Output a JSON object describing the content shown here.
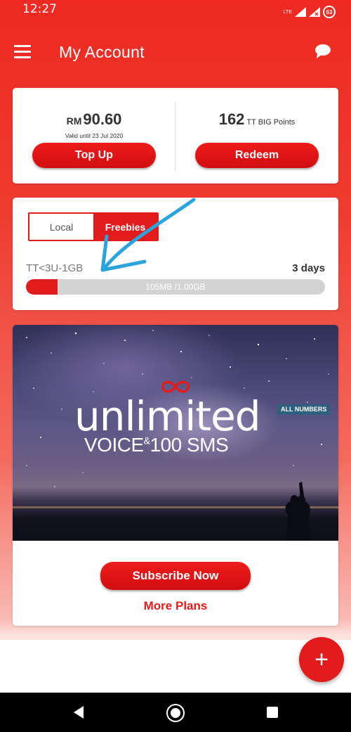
{
  "status_bar": {
    "time": "12:27",
    "network": "LTE",
    "battery": "63"
  },
  "header": {
    "title": "My Account",
    "menu_icon": "hamburger-menu-icon",
    "chat_icon": "chat-bubble-icon"
  },
  "balance": {
    "currency": "RM",
    "amount": "90.60",
    "valid_until": "Valid until 23 Jul 2020",
    "topup_label": "Top Up"
  },
  "points": {
    "value": "162",
    "label": "TT BIG Points",
    "redeem_label": "Redeem"
  },
  "usage": {
    "tabs": [
      {
        "label": "Local",
        "active": false
      },
      {
        "label": "Freebies",
        "active": true
      }
    ],
    "plan_name": "TT<3U-1GB",
    "days_left": "3 days",
    "usage_text": "105MB /1.00GB",
    "used_fraction": 0.105
  },
  "promo": {
    "headline": "unlimited",
    "badge": "ALL NUMBERS",
    "subline_voice": "VOICE",
    "subline_amp": "&",
    "subline_sms": "100 SMS",
    "subscribe_label": "Subscribe Now",
    "more_plans_label": "More Plans"
  },
  "fab": {
    "label": "+"
  },
  "colors": {
    "brand_red": "#e21c1c",
    "annotation_arrow": "#2ba3dd"
  }
}
